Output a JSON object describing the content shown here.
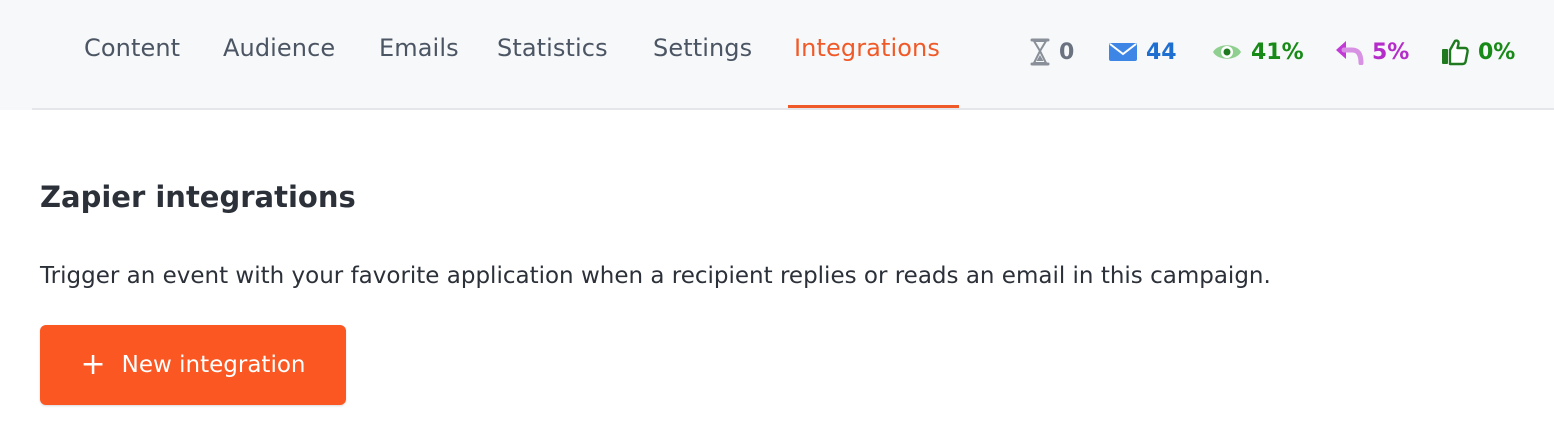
{
  "tabs": [
    {
      "label": "Content",
      "active": false
    },
    {
      "label": "Audience",
      "active": false
    },
    {
      "label": "Emails",
      "active": false
    },
    {
      "label": "Statistics",
      "active": false
    },
    {
      "label": "Settings",
      "active": false
    },
    {
      "label": "Integrations",
      "active": true
    }
  ],
  "stats": {
    "pending": {
      "value": "0",
      "icon": "hourglass-icon",
      "color": "#6b7280"
    },
    "sent": {
      "value": "44",
      "icon": "envelope-icon",
      "color": "#1f6fd1"
    },
    "opened": {
      "value": "41%",
      "icon": "eye-icon",
      "color": "#178a17"
    },
    "replied": {
      "value": "5%",
      "icon": "reply-icon",
      "color": "#b42cc9"
    },
    "interested": {
      "value": "0%",
      "icon": "thumbs-up-icon",
      "color": "#178a17"
    }
  },
  "section": {
    "title": "Zapier integrations",
    "description": "Trigger an event with your favorite application when a recipient replies or reads an email in this campaign.",
    "button_label": "New integration"
  },
  "colors": {
    "accent": "#f05a28",
    "button_bg": "#fa5722"
  }
}
